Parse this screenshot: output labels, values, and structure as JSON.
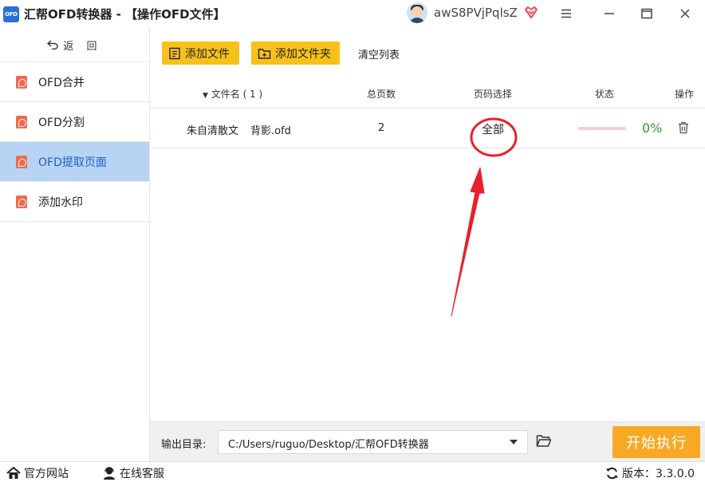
{
  "window": {
    "logo_text": "OFD",
    "title": "汇帮OFD转换器 - 【操作OFD文件】",
    "username": "awS8PVjPqlsZ"
  },
  "sidebar": {
    "back_label": "返 回",
    "items": [
      {
        "label": "OFD合并",
        "active": false
      },
      {
        "label": "OFD分割",
        "active": false
      },
      {
        "label": "OFD提取页面",
        "active": true
      },
      {
        "label": "添加水印",
        "active": false
      }
    ]
  },
  "toolbar": {
    "add_file": "添加文件",
    "add_folder": "添加文件夹",
    "clear_list": "清空列表"
  },
  "table": {
    "headers": {
      "filename": "文件名 ( 1 )",
      "total_pages": "总页数",
      "page_select": "页码选择",
      "status": "状态",
      "action": "操作"
    },
    "rows": [
      {
        "filename_part1": "朱自清散文",
        "filename_part2": "背影.ofd",
        "total_pages": "2",
        "page_select": "全部",
        "progress": 0,
        "progress_text": "0%"
      }
    ]
  },
  "bottom": {
    "output_label": "输出目录:",
    "output_path": "C:/Users/ruguo/Desktop/汇帮OFD转换器",
    "start_button": "开始执行"
  },
  "statusbar": {
    "website": "官方网站",
    "support": "在线客服",
    "version": "版本：3.3.0.0"
  },
  "colors": {
    "accent_yellow": "#f8c11a",
    "start_orange": "#f9a825",
    "sidebar_active_bg": "#b7d4f5",
    "sidebar_active_text": "#1f5fc4",
    "annotation_red": "#e8202a",
    "progress_green": "#2e9b2e"
  }
}
